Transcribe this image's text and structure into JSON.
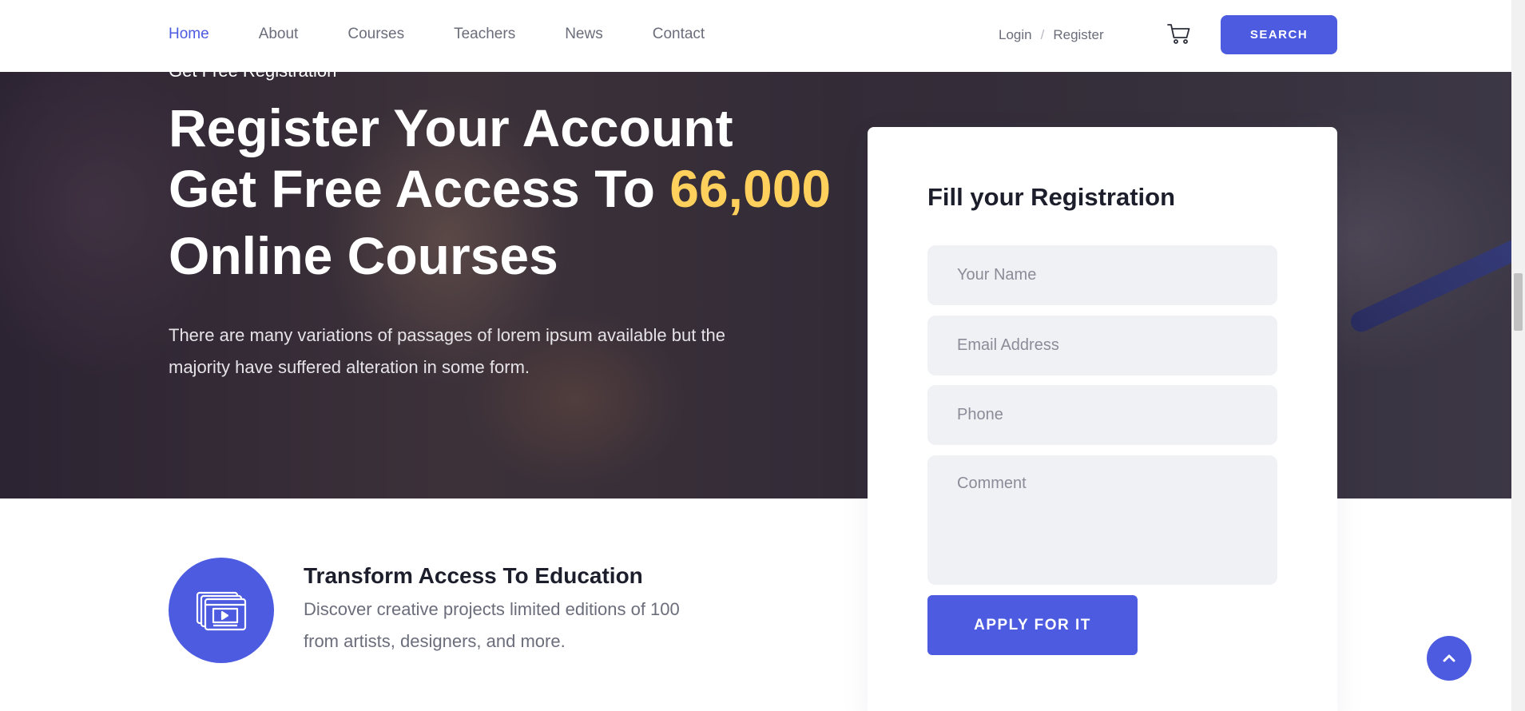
{
  "nav": {
    "items": [
      {
        "label": "Home",
        "active": true
      },
      {
        "label": "About"
      },
      {
        "label": "Courses"
      },
      {
        "label": "Teachers"
      },
      {
        "label": "News"
      },
      {
        "label": "Contact"
      }
    ],
    "login_label": "Login",
    "separator": "/",
    "register_label": "Register",
    "cart_icon": "cart-icon",
    "search_label": "SEARCH"
  },
  "hero": {
    "eyebrow": "Get Free Registration",
    "headline_line1": "Register Your Account",
    "headline_line2_prefix": "Get Free Access To ",
    "headline_highlight": "66,000",
    "headline_line3": "Online Courses",
    "description": "There are many variations of passages of lorem ipsum available but the majority have suffered alteration in some form."
  },
  "form": {
    "title": "Fill your Registration",
    "name_placeholder": "Your Name",
    "email_placeholder": "Email Address",
    "phone_placeholder": "Phone",
    "comment_placeholder": "Comment",
    "submit_label": "APPLY FOR IT"
  },
  "feature": {
    "icon": "video-player-icon",
    "title": "Transform Access To Education",
    "description": "Discover creative projects limited editions of 100 from artists, designers, and more."
  },
  "colors": {
    "accent": "#4c5be0",
    "highlight": "#ffd15c"
  }
}
